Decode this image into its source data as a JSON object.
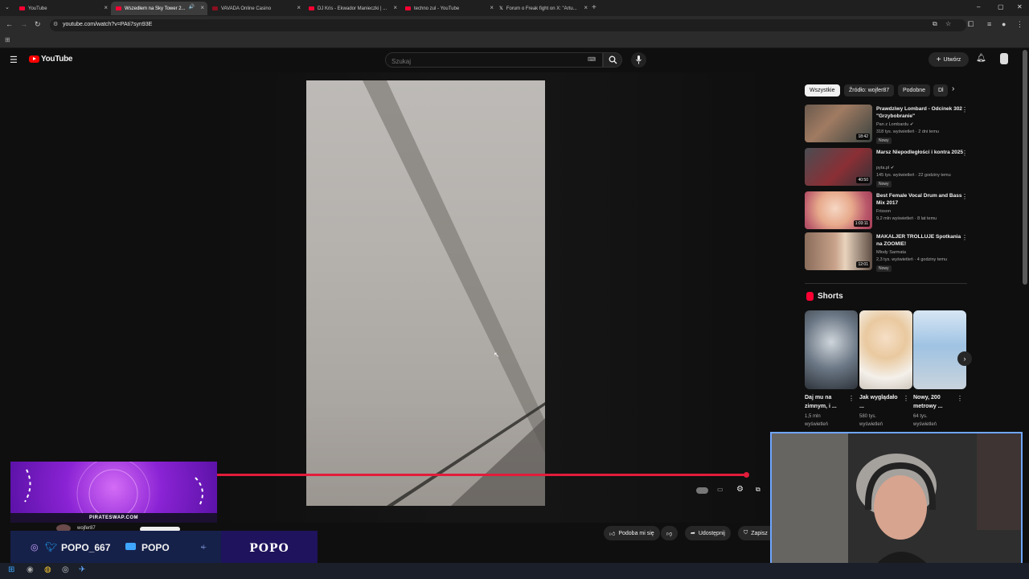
{
  "browser": {
    "tabs": [
      {
        "title": "YouTube",
        "active": false
      },
      {
        "title": "Wszedłem na Sky Tower 2...",
        "active": true
      },
      {
        "title": "VAVADA Online Casino",
        "active": false
      },
      {
        "title": "DJ Kris - Ekwador Manieczki | ...",
        "active": false
      },
      {
        "title": "techno zul - YouTube",
        "active": false
      },
      {
        "title": "Forum o Freak fight on X: \"Artu...",
        "active": false
      }
    ],
    "url": "youtube.com/watch?v=PAti7syn93E"
  },
  "youtube": {
    "logo_text": "YouTube",
    "search_placeholder": "Szukaj",
    "create_label": "Utwórz",
    "actions": {
      "like": "Podoba mi się",
      "share": "Udostępnij",
      "save": "Zapisz"
    },
    "chips": [
      "Wszystkie",
      "Źródło: wojfer87",
      "Podobne",
      "Dl"
    ],
    "recommendations": [
      {
        "title": "Prawdziwy Lombard - Odcinek 302 \"Grzybobranie\"",
        "channel": "Pan z Lombardu",
        "views": "318 tys. wyświetleń",
        "age": "2 dni temu",
        "duration": "18:42",
        "badge": "Nowy",
        "verified": true
      },
      {
        "title": "Marsz Niepodległości i kontra 2025",
        "channel": "pyta.pl",
        "views": "145 tys. wyświetleń",
        "age": "22 godziny temu",
        "duration": "40:50",
        "badge": "Nowy",
        "verified": true
      },
      {
        "title": "Best Female Vocal Drum and Bass Mix 2017",
        "channel": "Frisson",
        "views": "9,2 mln wyświetleń",
        "age": "8 lat temu",
        "duration": "1:03:11",
        "badge": "",
        "verified": false
      },
      {
        "title": "MAKALJER TROLLUJE Spotkania na ZOOMIE!",
        "channel": "Młody Sarmata",
        "views": "2,3 tys. wyświetleń",
        "age": "4 godziny temu",
        "duration": "12:01",
        "badge": "Nowy",
        "verified": false
      }
    ],
    "shorts_heading": "Shorts",
    "shorts": [
      {
        "title": "Daj mu na zimnym, i ...",
        "views": "1,5 mln",
        "views_label": "wyświetleń"
      },
      {
        "title": "Jak wyglądało ...",
        "views": "580 tys.",
        "views_label": "wyświetleń"
      },
      {
        "title": "Nowy, 200 metrowy ...",
        "views": "64 tys.",
        "views_label": "wyświetleń"
      }
    ]
  },
  "stream_overlay": {
    "banner_text": "PIRATESWAP.COM",
    "small_name": "wojfer87",
    "social_handle": "POPO_667",
    "youtube_name": "POPO",
    "box_text": "POPO"
  },
  "colors": {
    "accent_red": "#e21c3a",
    "youtube_red": "#ff0000",
    "overlay_purple": "#8a23d4"
  }
}
